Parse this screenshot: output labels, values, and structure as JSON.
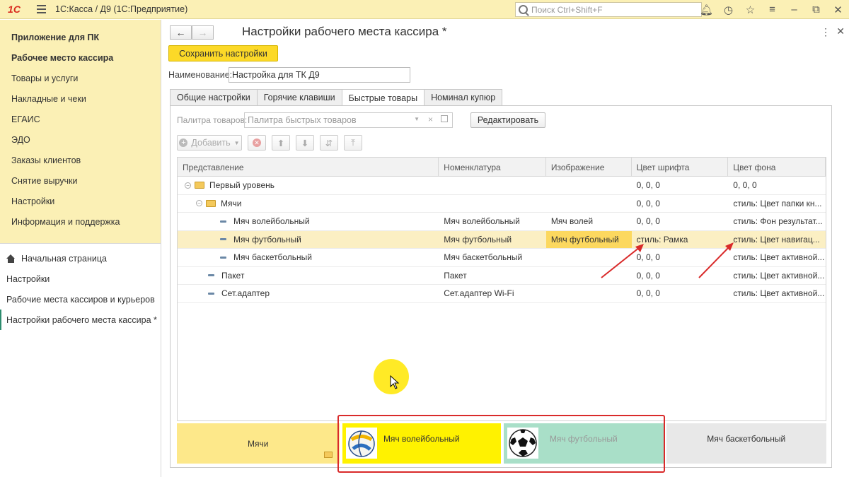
{
  "titlebar": {
    "logo": "1С",
    "title": "1С:Касса / Д9  (1С:Предприятие)",
    "search_placeholder": "Поиск Ctrl+Shift+F"
  },
  "sections": [
    {
      "label": "Приложение для ПК"
    },
    {
      "label": "Рабочее место кассира"
    },
    {
      "label": "Товары и услуги"
    },
    {
      "label": "Накладные и чеки"
    },
    {
      "label": "ЕГАИС"
    },
    {
      "label": "ЭДО"
    },
    {
      "label": "Заказы клиентов"
    },
    {
      "label": "Снятие выручки"
    },
    {
      "label": "Настройки"
    },
    {
      "label": "Информация и поддержка"
    }
  ],
  "nav": [
    {
      "label": "Начальная страница"
    },
    {
      "label": "Настройки"
    },
    {
      "label": "Рабочие места кассиров и курьеров"
    },
    {
      "label": "Настройки рабочего места кассира *"
    }
  ],
  "form": {
    "title": "Настройки рабочего места кассира *",
    "save_label": "Сохранить настройки",
    "name_label": "Наименование:",
    "name_value": "Настройка для ТК Д9",
    "tabs": [
      {
        "label": "Общие настройки"
      },
      {
        "label": "Горячие клавиши"
      },
      {
        "label": "Быстрые товары"
      },
      {
        "label": "Номинал купюр"
      }
    ],
    "palette_label": "Палитра товаров:",
    "palette_value": "Палитра быстрых товаров",
    "edit_label": "Редактировать",
    "add_label": "Добавить"
  },
  "table": {
    "columns": [
      "Представление",
      "Номенклатура",
      "Изображение",
      "Цвет шрифта",
      "Цвет фона"
    ],
    "rows": [
      {
        "name": "Первый уровень",
        "nom": "",
        "img": "",
        "font": "0, 0, 0",
        "bg": "0, 0, 0"
      },
      {
        "name": "Мячи",
        "nom": "",
        "img": "",
        "font": "0, 0, 0",
        "bg": "стиль: Цвет папки кн..."
      },
      {
        "name": "Мяч волейбольный",
        "nom": "Мяч волейбольный",
        "img": "Мяч волей",
        "font": "0, 0, 0",
        "bg": "стиль: Фон результат..."
      },
      {
        "name": "Мяч футбольный",
        "nom": "Мяч футбольный",
        "img": "Мяч футбольный",
        "font": "стиль: Рамка",
        "bg": "стиль: Цвет навигац..."
      },
      {
        "name": "Мяч баскетбольный",
        "nom": "Мяч баскетбольный",
        "img": "",
        "font": "0, 0, 0",
        "bg": "стиль: Цвет активной..."
      },
      {
        "name": "Пакет",
        "nom": "Пакет",
        "img": "",
        "font": "0, 0, 0",
        "bg": "стиль: Цвет активной..."
      },
      {
        "name": "Сет.адаптер",
        "nom": "Сет.адаптер Wi-Fi",
        "img": "",
        "font": "0, 0, 0",
        "bg": "стиль: Цвет активной..."
      }
    ]
  },
  "tiles": {
    "folder": "Мячи",
    "volley": "Мяч волейбольный",
    "football": "Мяч футбольный",
    "basket": "Мяч баскетбольный"
  },
  "colors": {
    "accent_yellow": "#fcd928",
    "panel_bg": "#fbf0b5",
    "selected_row": "#fbefc3",
    "annotation_red": "#d92a2a"
  }
}
